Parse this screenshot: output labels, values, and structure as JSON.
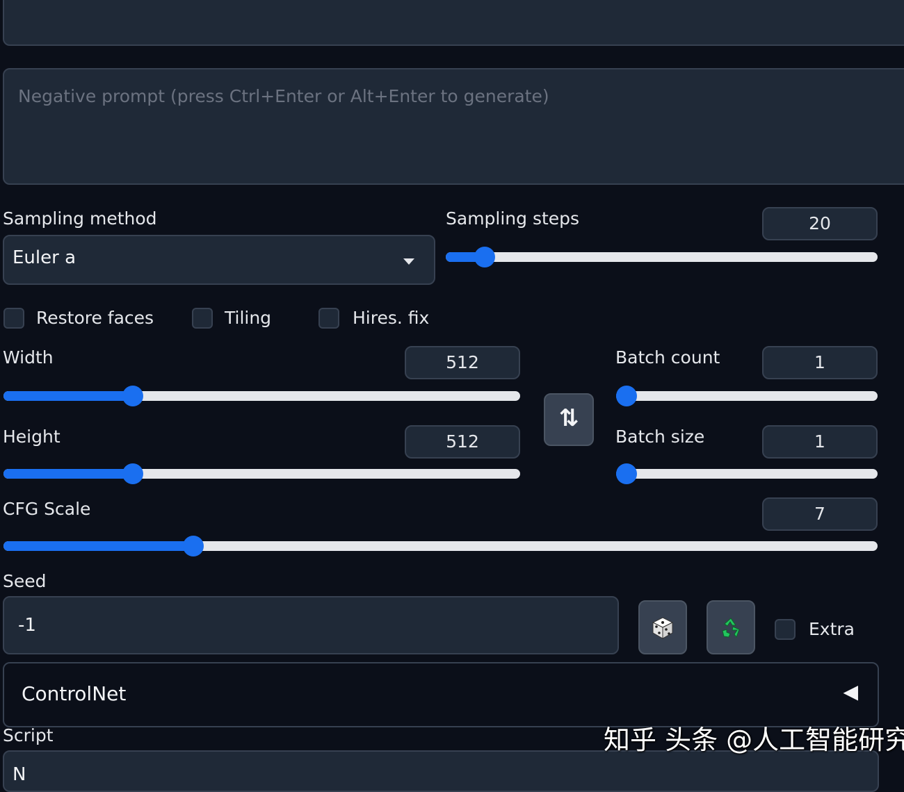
{
  "prompt": {
    "placeholder": ""
  },
  "negative_prompt": {
    "placeholder": "Negative prompt (press Ctrl+Enter or Alt+Enter to generate)"
  },
  "sampling_method": {
    "label": "Sampling method",
    "value": "Euler a"
  },
  "sampling_steps": {
    "label": "Sampling steps",
    "value": "20",
    "slider_fraction": 0.07
  },
  "options": {
    "restore_faces": "Restore faces",
    "tiling": "Tiling",
    "hires_fix": "Hires. fix"
  },
  "width": {
    "label": "Width",
    "value": "512",
    "slider_fraction": 0.24
  },
  "height": {
    "label": "Height",
    "value": "512",
    "slider_fraction": 0.24
  },
  "swap": {
    "icon": "swap-arrows-icon",
    "glyph": "⇅"
  },
  "batch_count": {
    "label": "Batch count",
    "value": "1",
    "slider_fraction": 0.0
  },
  "batch_size": {
    "label": "Batch size",
    "value": "1",
    "slider_fraction": 0.0
  },
  "cfg_scale": {
    "label": "CFG Scale",
    "value": "7",
    "slider_fraction": 0.21
  },
  "seed": {
    "label": "Seed",
    "value": "-1",
    "extra_label": "Extra",
    "dice_icon": "dice-icon",
    "recycle_icon": "recycle-icon"
  },
  "controlnet": {
    "label": "ControlNet",
    "arrow_glyph": "◀"
  },
  "script": {
    "label": "Script",
    "value": "N"
  },
  "watermark": {
    "text": "知乎 头条 @人工智能研究所"
  },
  "colors": {
    "background": "#0b0f19",
    "panel": "#1f2937",
    "border": "#374151",
    "accent": "#1a6ff0",
    "track": "#e5e7eb"
  }
}
